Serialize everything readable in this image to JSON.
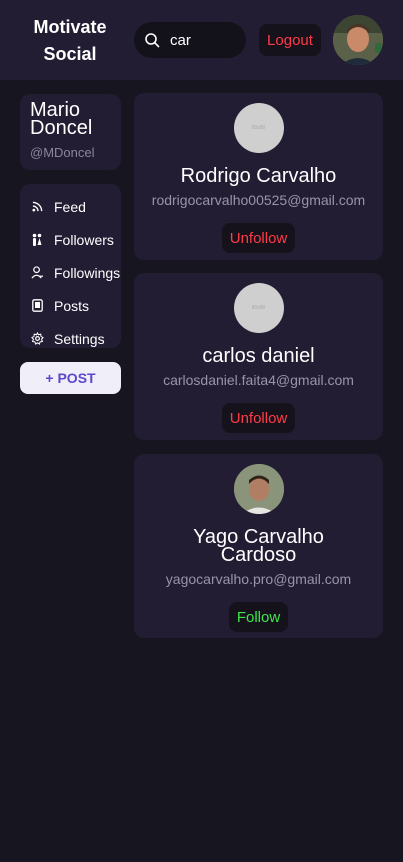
{
  "header": {
    "brand": "Motivate Social",
    "search": {
      "value": "car",
      "placeholder": ""
    },
    "logout_label": "Logout"
  },
  "profile": {
    "name": "Mario Doncel",
    "handle": "@MDoncel"
  },
  "menu": {
    "items": [
      {
        "label": "Feed",
        "icon": "rss-icon"
      },
      {
        "label": "Followers",
        "icon": "people-icon"
      },
      {
        "label": "Followings",
        "icon": "user-icon"
      },
      {
        "label": "Posts",
        "icon": "posts-icon"
      },
      {
        "label": "Settings",
        "icon": "gear-icon"
      }
    ]
  },
  "post_button": "+ POST",
  "results": [
    {
      "name": "Rodrigo Carvalho",
      "email": "rodrigocarvalho00525@gmail.com",
      "action": "Unfollow",
      "avatar_placeholder": "80x80"
    },
    {
      "name": "carlos daniel",
      "email": "carlosdaniel.faita4@gmail.com",
      "action": "Unfollow",
      "avatar_placeholder": "80x80"
    },
    {
      "name": "Yago Carvalho Cardoso",
      "email": "yagocarvalho.pro@gmail.com",
      "action": "Follow"
    }
  ],
  "colors": {
    "background": "#17151f",
    "panel": "#221d33",
    "danger": "#ff3b48",
    "success": "#3ee64a",
    "accent": "#5b48cc"
  }
}
